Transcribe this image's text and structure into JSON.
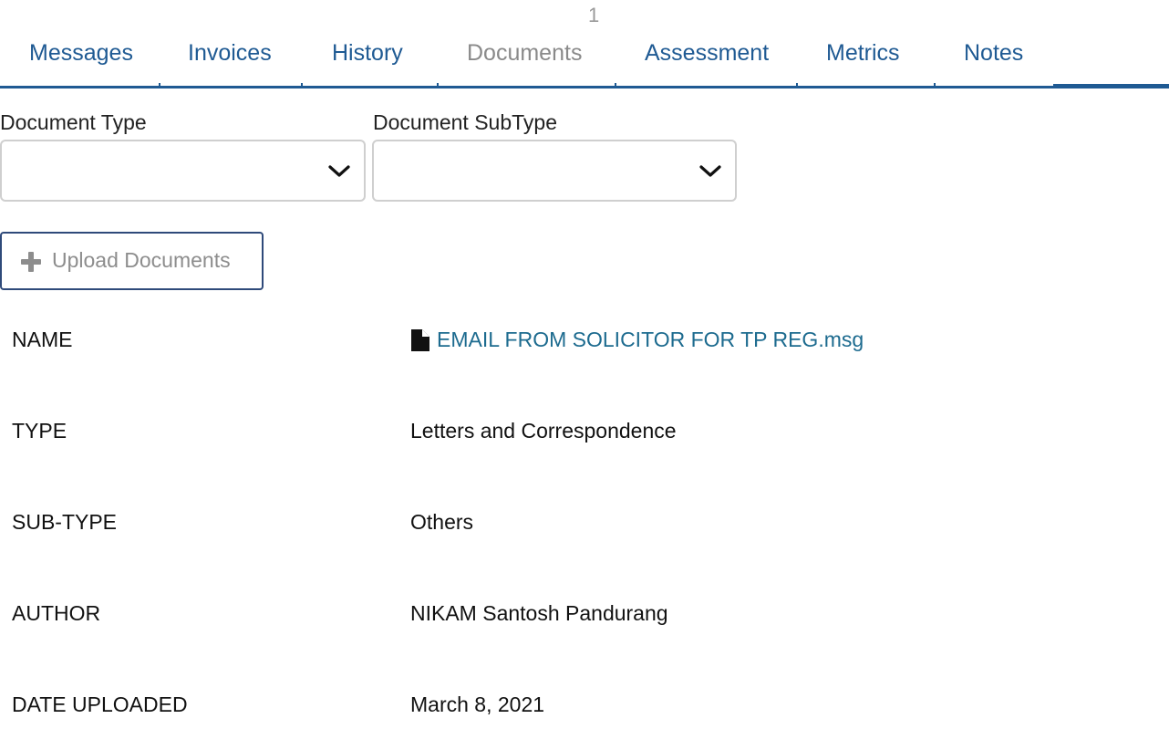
{
  "tabs": {
    "badge_count": "1",
    "items": [
      {
        "label": "Messages"
      },
      {
        "label": "Invoices"
      },
      {
        "label": "History"
      },
      {
        "label": "Documents"
      },
      {
        "label": "Assessment"
      },
      {
        "label": "Metrics"
      },
      {
        "label": "Notes"
      }
    ],
    "accent_color": "#1f5a93",
    "disabled_color": "#8a8a8a"
  },
  "filters": {
    "document_type_label": "Document Type",
    "document_type_value": "",
    "document_subtype_label": "Document SubType",
    "document_subtype_value": ""
  },
  "upload": {
    "label": "Upload Documents",
    "icon": "plus-icon"
  },
  "document": {
    "name_key": "NAME",
    "name_value": "EMAIL FROM SOLICITOR FOR TP REG.msg",
    "name_icon": "file-icon",
    "type_key": "TYPE",
    "type_value": "Letters and Correspondence",
    "subtype_key": "SUB-TYPE",
    "subtype_value": "Others",
    "author_key": "AUTHOR",
    "author_value": "NIKAM Santosh Pandurang",
    "date_key": "DATE UPLOADED",
    "date_value": "March 8, 2021",
    "link_color": "#1d6b8f"
  }
}
